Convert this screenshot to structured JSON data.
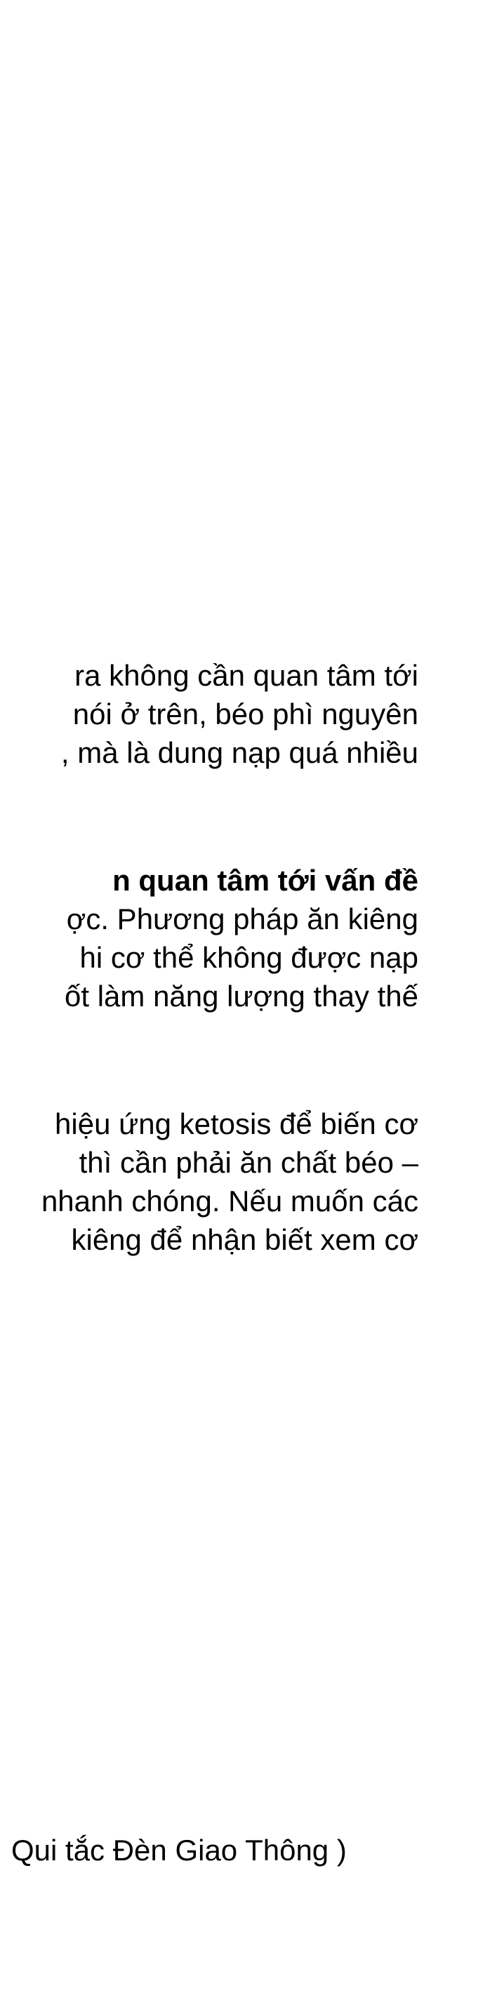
{
  "paragraphs": [
    {
      "lines": [
        "ra không cần quan tâm tới",
        "nói ở trên, béo phì nguyên",
        ", mà là dung nạp quá nhiều"
      ]
    },
    {
      "lines": [
        "n quan tâm tới vấn đề",
        "ợc. Phương pháp ăn kiêng",
        "hi cơ thể không được nạp",
        "ốt làm năng lượng thay thế"
      ]
    },
    {
      "lines": [
        "hiệu ứng ketosis để biến cơ",
        "thì cần phải ăn chất béo –",
        "nhanh chóng. Nếu muốn các",
        "kiêng để nhận biết xem cơ"
      ]
    }
  ],
  "footer": {
    "text": "Qui tắc Đèn Giao Thông )"
  }
}
